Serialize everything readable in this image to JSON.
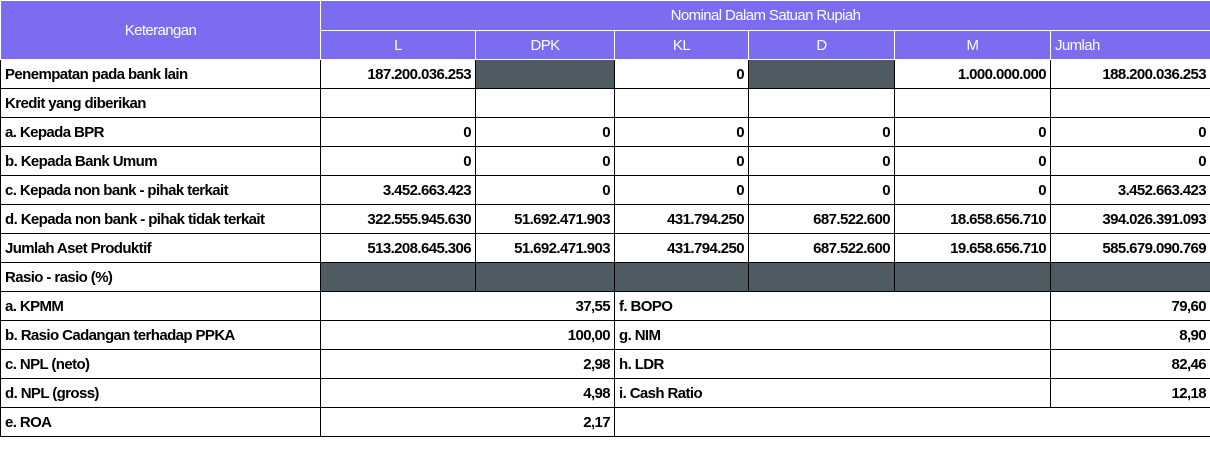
{
  "header": {
    "keterangan": "Keterangan",
    "nominal": "Nominal Dalam Satuan Rupiah",
    "cols": [
      "L",
      "DPK",
      "KL",
      "D",
      "M",
      "Jumlah"
    ]
  },
  "rows": [
    {
      "label": "Penempatan pada bank lain",
      "values": [
        "187.200.036.253",
        "",
        "0",
        "",
        "1.000.000.000",
        "188.200.036.253"
      ]
    },
    {
      "label": "Kredit yang diberikan",
      "values": [
        "",
        "",
        "",
        "",
        "",
        ""
      ]
    },
    {
      "label": "a. Kepada BPR",
      "values": [
        "0",
        "0",
        "0",
        "0",
        "0",
        "0"
      ]
    },
    {
      "label": "b. Kepada Bank Umum",
      "values": [
        "0",
        "0",
        "0",
        "0",
        "0",
        "0"
      ]
    },
    {
      "label": "c. Kepada non bank - pihak terkait",
      "values": [
        "3.452.663.423",
        "0",
        "0",
        "0",
        "0",
        "3.452.663.423"
      ]
    },
    {
      "label": "d. Kepada non bank - pihak tidak terkait",
      "values": [
        "322.555.945.630",
        "51.692.471.903",
        "431.794.250",
        "687.522.600",
        "18.658.656.710",
        "394.026.391.093"
      ]
    },
    {
      "label": "Jumlah Aset Produktif",
      "values": [
        "513.208.645.306",
        "51.692.471.903",
        "431.794.250",
        "687.522.600",
        "19.658.656.710",
        "585.679.090.769"
      ]
    }
  ],
  "rasio": {
    "title": "Rasio - rasio (%)",
    "rows": [
      {
        "left_label": "a. KPMM",
        "left_value": "37,55",
        "right_label": "f. BOPO",
        "right_value": "79,60"
      },
      {
        "left_label": "b. Rasio Cadangan terhadap PPKA",
        "left_value": "100,00",
        "right_label": "g. NIM",
        "right_value": "8,90"
      },
      {
        "left_label": "c. NPL (neto)",
        "left_value": "2,98",
        "right_label": "h. LDR",
        "right_value": "82,46"
      },
      {
        "left_label": "d. NPL (gross)",
        "left_value": "4,98",
        "right_label": "i. Cash Ratio",
        "right_value": "12,18"
      },
      {
        "left_label": "e. ROA",
        "left_value": "2,17",
        "right_label": "",
        "right_value": ""
      }
    ]
  }
}
